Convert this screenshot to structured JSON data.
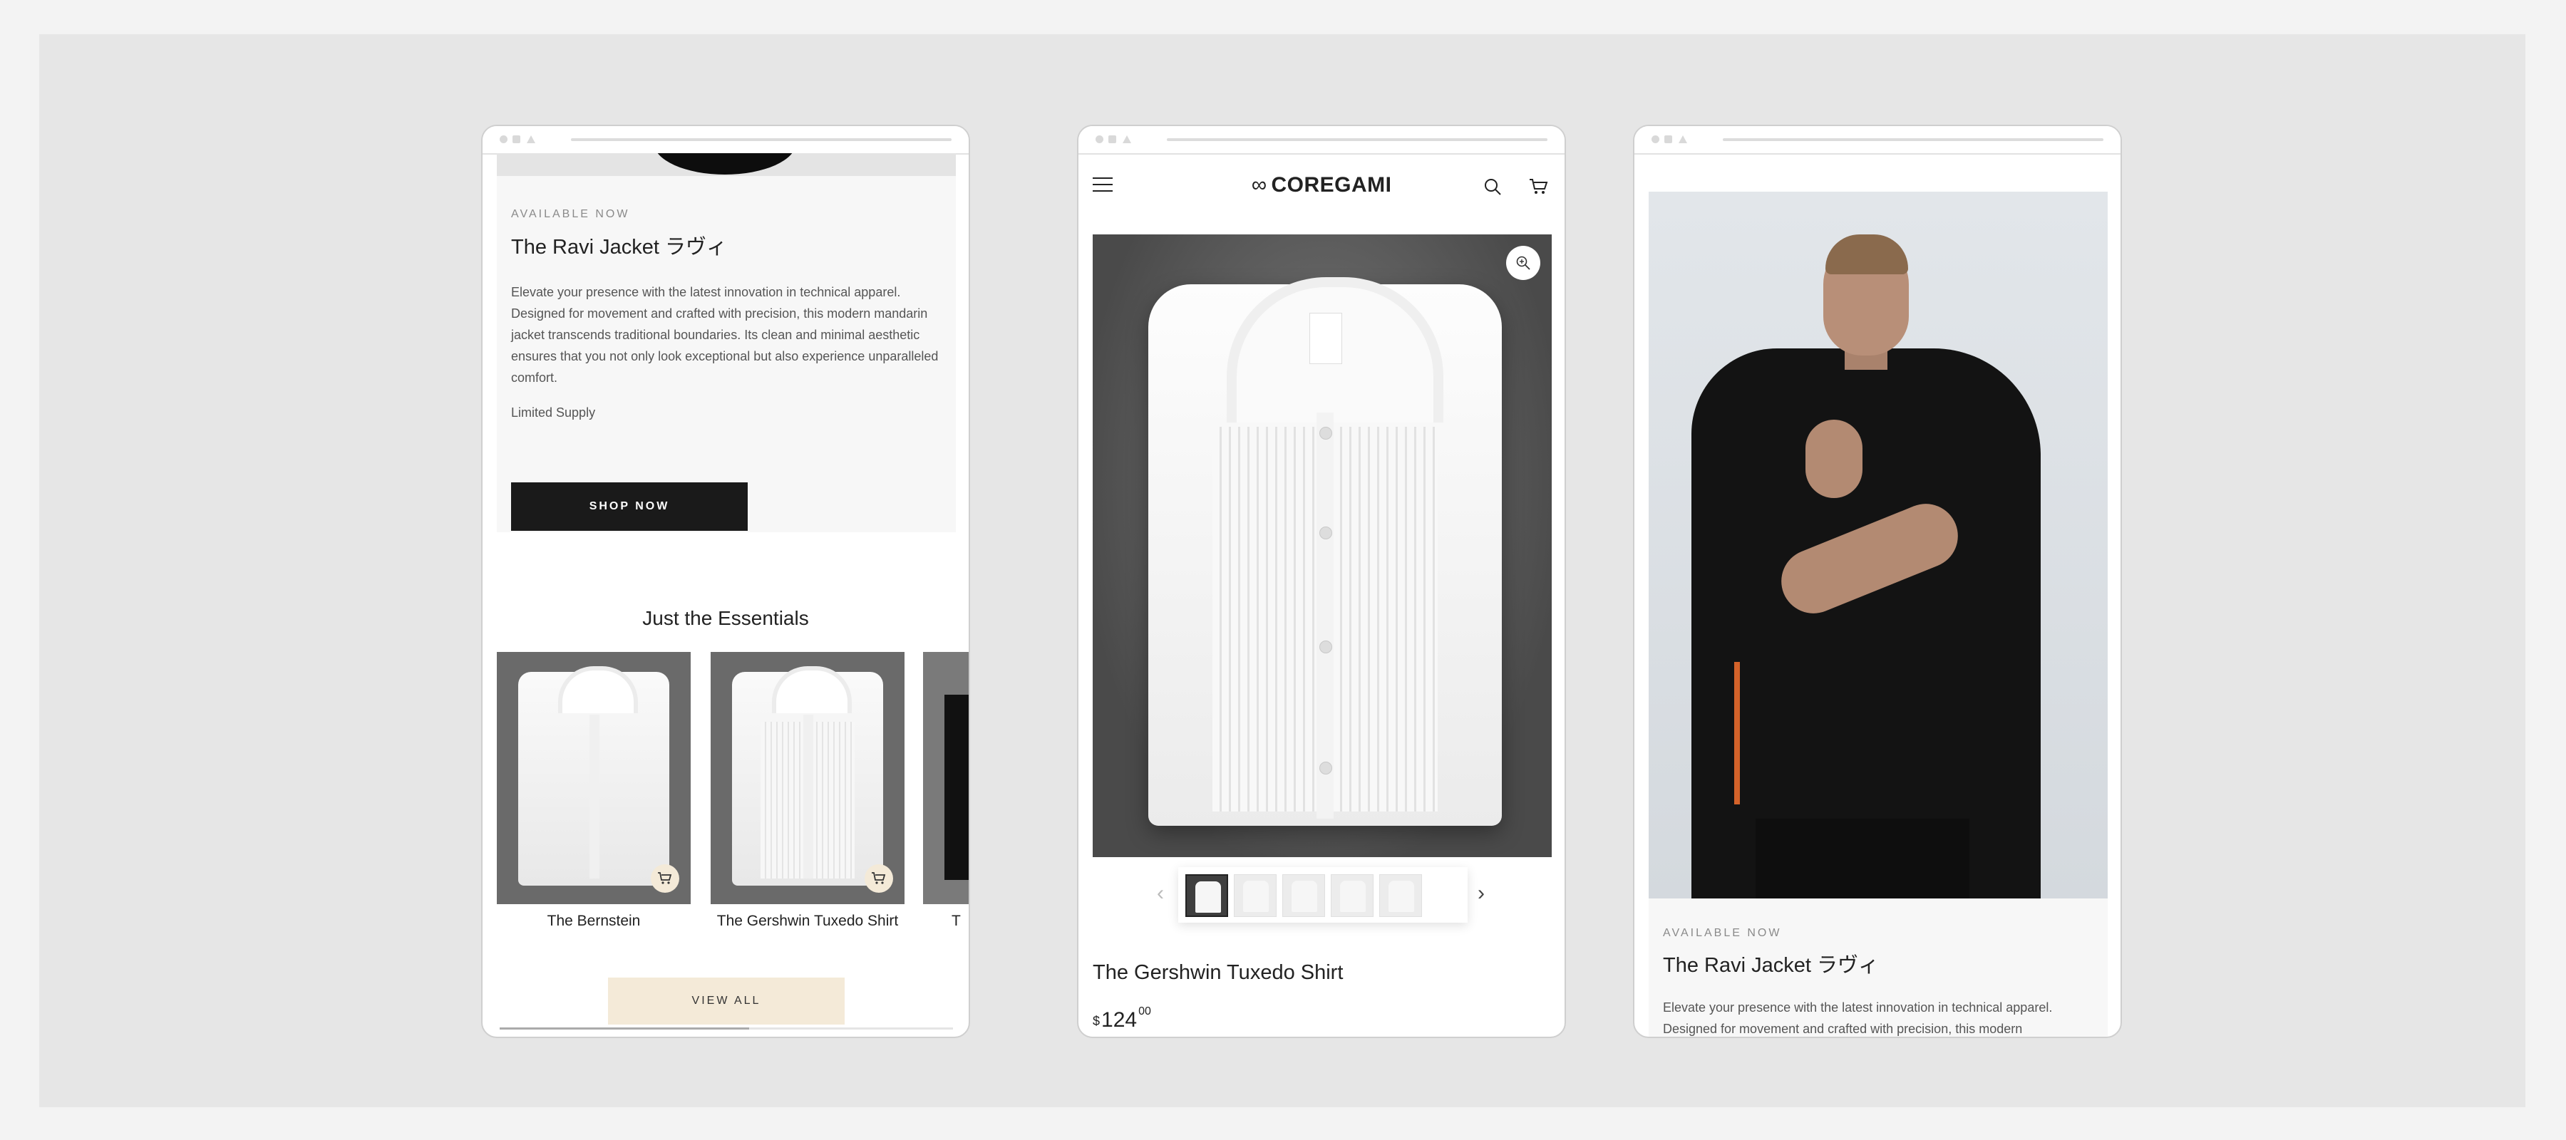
{
  "promo": {
    "eyebrow": "AVAILABLE NOW",
    "title": "The Ravi Jacket ラヴィ",
    "description": "Elevate your presence with the latest innovation in technical apparel. Designed for movement and crafted with precision, this modern mandarin jacket transcends traditional boundaries. Its clean and minimal aesthetic ensures that you not only look exceptional but also experience unparalleled comfort.",
    "supply": "Limited Supply",
    "cta": "SHOP NOW"
  },
  "essentials": {
    "title": "Just the Essentials",
    "products": [
      {
        "name": "The Bernstein"
      },
      {
        "name": "The Gershwin Tuxedo Shirt"
      },
      {
        "name": "T"
      }
    ],
    "view_all": "VIEW ALL",
    "scroll_fraction": 0.55
  },
  "header": {
    "logo_mark": "∞",
    "logo_text": "COREGAMI",
    "icons": [
      "menu-icon",
      "search-icon",
      "cart-icon"
    ]
  },
  "product": {
    "title": "The Gershwin Tuxedo Shirt",
    "price_currency": "$",
    "price_whole": "124",
    "price_cents": "00",
    "thumbnail_count": 5,
    "active_thumbnail": 1
  },
  "hero_info": {
    "eyebrow": "AVAILABLE NOW",
    "title": "The Ravi Jacket ラヴィ",
    "description": "Elevate your presence with the latest innovation in technical apparel. Designed for movement and crafted with precision, this modern"
  },
  "colors": {
    "background": "#e6e6e6",
    "accent_light": "#f4ead8",
    "button_dark": "#1a1a1a"
  }
}
